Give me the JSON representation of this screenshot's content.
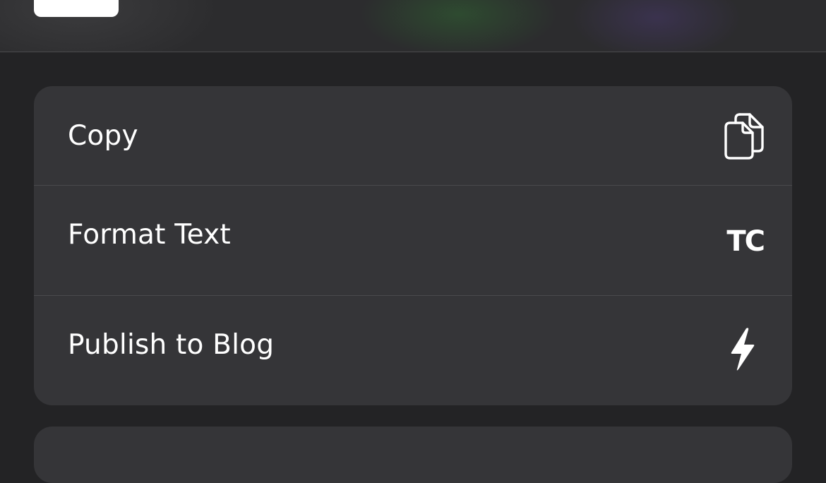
{
  "actions": [
    {
      "label": "Copy",
      "icon": "copy-icon"
    },
    {
      "label": "Format Text",
      "icon": "text-case-icon",
      "icon_text": "TC"
    },
    {
      "label": "Publish to Blog",
      "icon": "bolt-icon"
    }
  ],
  "colors": {
    "background": "#232325",
    "group_background": "#353538",
    "divider": "#4a4a4d",
    "text": "#ffffff"
  }
}
